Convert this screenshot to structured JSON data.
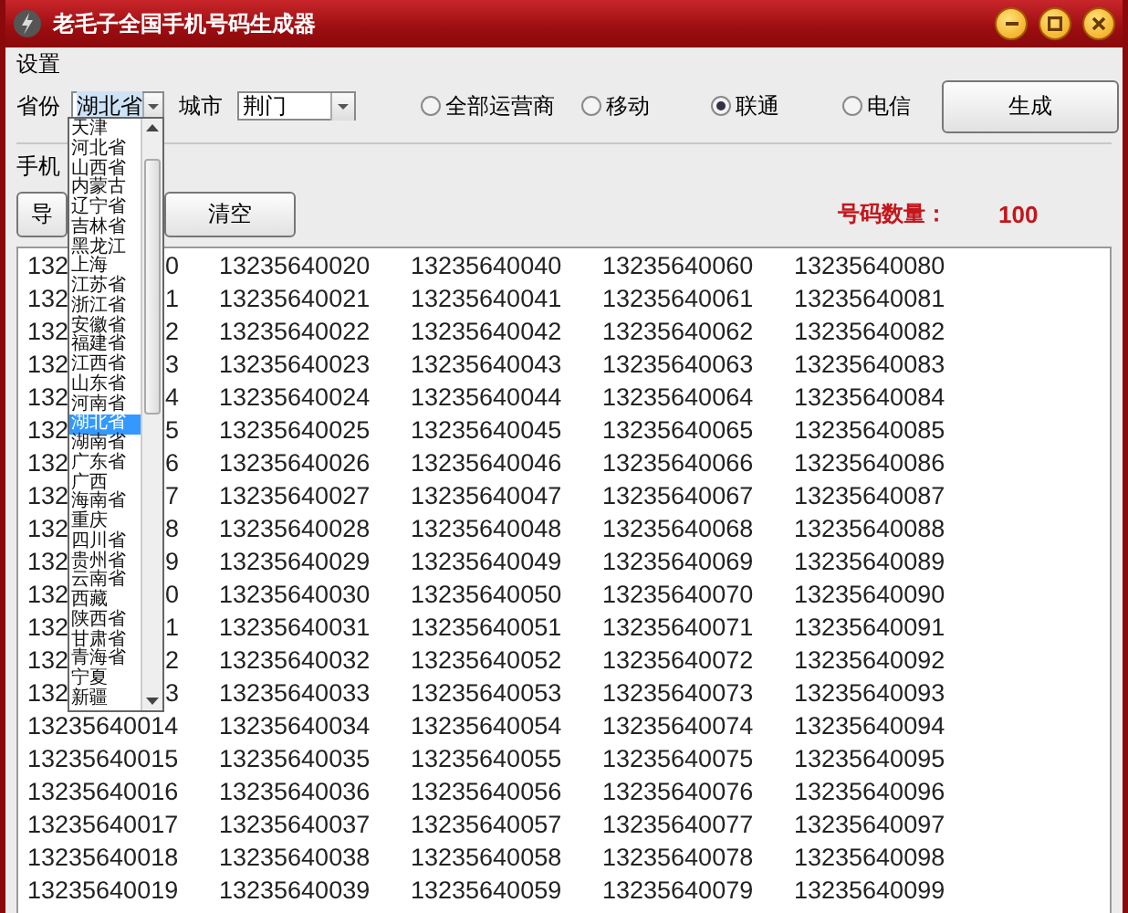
{
  "window": {
    "title": "老毛子全国手机号码生成器"
  },
  "settings": {
    "title": "设置",
    "province_label": "省份",
    "province_value": "湖北省",
    "city_label": "城市",
    "city_value": "荆门",
    "generate_button": "生成",
    "operators": [
      {
        "label": "全部运营商",
        "selected": false
      },
      {
        "label": "移动",
        "selected": false
      },
      {
        "label": "联通",
        "selected": true
      },
      {
        "label": "电信",
        "selected": false
      }
    ]
  },
  "province_dropdown": {
    "items": [
      {
        "label": "天津",
        "selected": false
      },
      {
        "label": "河北省",
        "selected": false
      },
      {
        "label": "山西省",
        "selected": false
      },
      {
        "label": "内蒙古",
        "selected": false
      },
      {
        "label": "辽宁省",
        "selected": false
      },
      {
        "label": "吉林省",
        "selected": false
      },
      {
        "label": "黑龙江",
        "selected": false
      },
      {
        "label": "上海",
        "selected": false
      },
      {
        "label": "江苏省",
        "selected": false
      },
      {
        "label": "浙江省",
        "selected": false
      },
      {
        "label": "安徽省",
        "selected": false
      },
      {
        "label": "福建省",
        "selected": false
      },
      {
        "label": "江西省",
        "selected": false
      },
      {
        "label": "山东省",
        "selected": false
      },
      {
        "label": "河南省",
        "selected": false
      },
      {
        "label": "湖北省",
        "selected": true
      },
      {
        "label": "湖南省",
        "selected": false
      },
      {
        "label": "广东省",
        "selected": false
      },
      {
        "label": "广西",
        "selected": false
      },
      {
        "label": "海南省",
        "selected": false
      },
      {
        "label": "重庆",
        "selected": false
      },
      {
        "label": "四川省",
        "selected": false
      },
      {
        "label": "贵州省",
        "selected": false
      },
      {
        "label": "云南省",
        "selected": false
      },
      {
        "label": "西藏",
        "selected": false
      },
      {
        "label": "陕西省",
        "selected": false
      },
      {
        "label": "甘肃省",
        "selected": false
      },
      {
        "label": "青海省",
        "selected": false
      },
      {
        "label": "宁夏",
        "selected": false
      },
      {
        "label": "新疆",
        "selected": false
      }
    ]
  },
  "numbers_group": {
    "title": "手机",
    "buttons": [
      "导",
      "清空"
    ],
    "count_label": "号码数量：",
    "count_value": "100"
  },
  "numbers": {
    "rows": [
      [
        {
          "head": "132",
          "tail": "0"
        },
        "13235640020",
        "13235640040",
        "13235640060",
        "13235640080"
      ],
      [
        {
          "head": "132",
          "tail": "1"
        },
        "13235640021",
        "13235640041",
        "13235640061",
        "13235640081"
      ],
      [
        {
          "head": "132",
          "tail": "2"
        },
        "13235640022",
        "13235640042",
        "13235640062",
        "13235640082"
      ],
      [
        {
          "head": "132",
          "tail": "3"
        },
        "13235640023",
        "13235640043",
        "13235640063",
        "13235640083"
      ],
      [
        {
          "head": "132",
          "tail": "4"
        },
        "13235640024",
        "13235640044",
        "13235640064",
        "13235640084"
      ],
      [
        {
          "head": "132",
          "tail": "5"
        },
        "13235640025",
        "13235640045",
        "13235640065",
        "13235640085"
      ],
      [
        {
          "head": "132",
          "tail": "6"
        },
        "13235640026",
        "13235640046",
        "13235640066",
        "13235640086"
      ],
      [
        {
          "head": "132",
          "tail": "7"
        },
        "13235640027",
        "13235640047",
        "13235640067",
        "13235640087"
      ],
      [
        {
          "head": "132",
          "tail": "8"
        },
        "13235640028",
        "13235640048",
        "13235640068",
        "13235640088"
      ],
      [
        {
          "head": "132",
          "tail": "9"
        },
        "13235640029",
        "13235640049",
        "13235640069",
        "13235640089"
      ],
      [
        {
          "head": "132",
          "tail": "0"
        },
        "13235640030",
        "13235640050",
        "13235640070",
        "13235640090"
      ],
      [
        {
          "head": "132",
          "tail": "1"
        },
        "13235640031",
        "13235640051",
        "13235640071",
        "13235640091"
      ],
      [
        {
          "head": "132",
          "tail": "2"
        },
        "13235640032",
        "13235640052",
        "13235640072",
        "13235640092"
      ],
      [
        {
          "head": "132",
          "tail": "3"
        },
        "13235640033",
        "13235640053",
        "13235640073",
        "13235640093"
      ],
      [
        "13235640014",
        "13235640034",
        "13235640054",
        "13235640074",
        "13235640094"
      ],
      [
        "13235640015",
        "13235640035",
        "13235640055",
        "13235640075",
        "13235640095"
      ],
      [
        "13235640016",
        "13235640036",
        "13235640056",
        "13235640076",
        "13235640096"
      ],
      [
        "13235640017",
        "13235640037",
        "13235640057",
        "13235640077",
        "13235640097"
      ],
      [
        "13235640018",
        "13235640038",
        "13235640058",
        "13235640078",
        "13235640098"
      ],
      [
        "13235640019",
        "13235640039",
        "13235640059",
        "13235640079",
        "13235640099"
      ]
    ]
  }
}
